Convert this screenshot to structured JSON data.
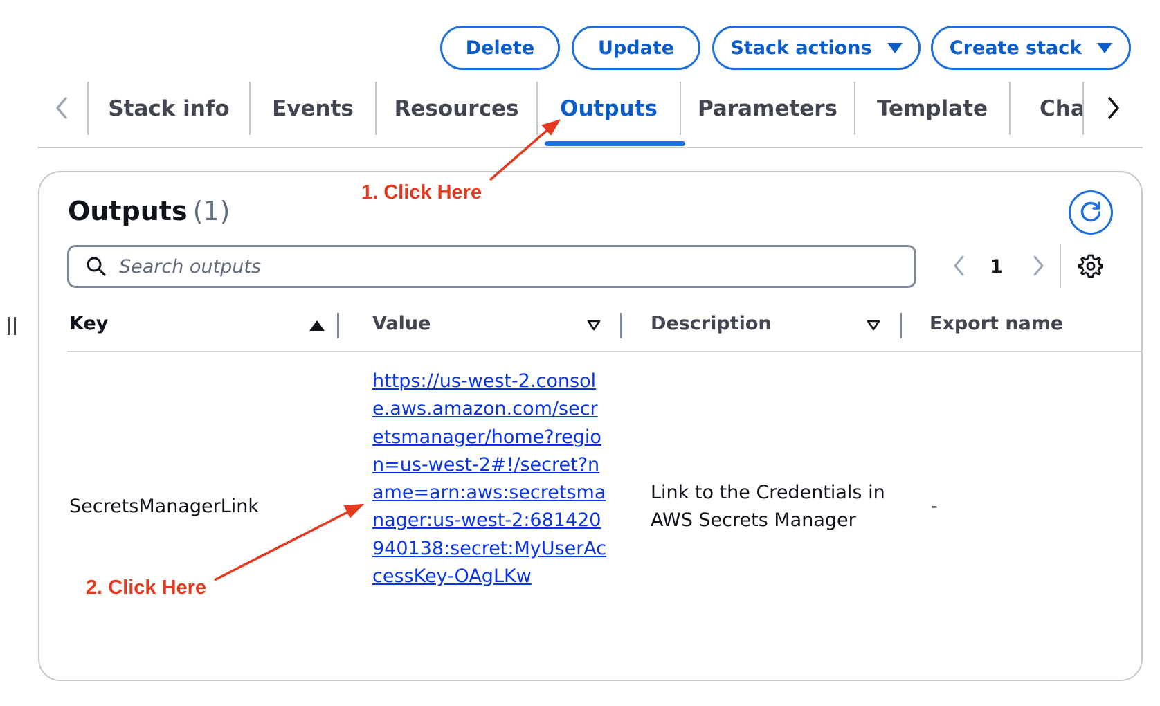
{
  "toolbar": {
    "delete_label": "Delete",
    "update_label": "Update",
    "stack_actions_label": "Stack actions",
    "create_stack_label": "Create stack"
  },
  "tabs": [
    {
      "label": "Stack info",
      "active": false
    },
    {
      "label": "Events",
      "active": false
    },
    {
      "label": "Resources",
      "active": false
    },
    {
      "label": "Outputs",
      "active": true
    },
    {
      "label": "Parameters",
      "active": false
    },
    {
      "label": "Template",
      "active": false
    },
    {
      "label": "Char",
      "active": false
    }
  ],
  "outputs": {
    "title": "Outputs",
    "count": "(1)",
    "search_placeholder": "Search outputs",
    "page": "1",
    "columns": {
      "key": "Key",
      "value": "Value",
      "description": "Description",
      "export_name": "Export name"
    },
    "rows": [
      {
        "key": "SecretsManagerLink",
        "value": "https://us-west-2.console.aws.amazon.com/secretsmanager/home?region=us-west-2#!/secret?name=arn:aws:secretsmanager:us-west-2:681420940138:secret:MyUserAccessKey-OAgLKw",
        "description": "Link to the Credentials in AWS Secrets Manager",
        "export_name": "-"
      }
    ]
  },
  "annotations": {
    "step1": "1. Click Here",
    "step2": "2. Click Here",
    "color": "#e33a20"
  },
  "colors": {
    "accent": "#1d6fe0",
    "link": "#0a35e6"
  }
}
